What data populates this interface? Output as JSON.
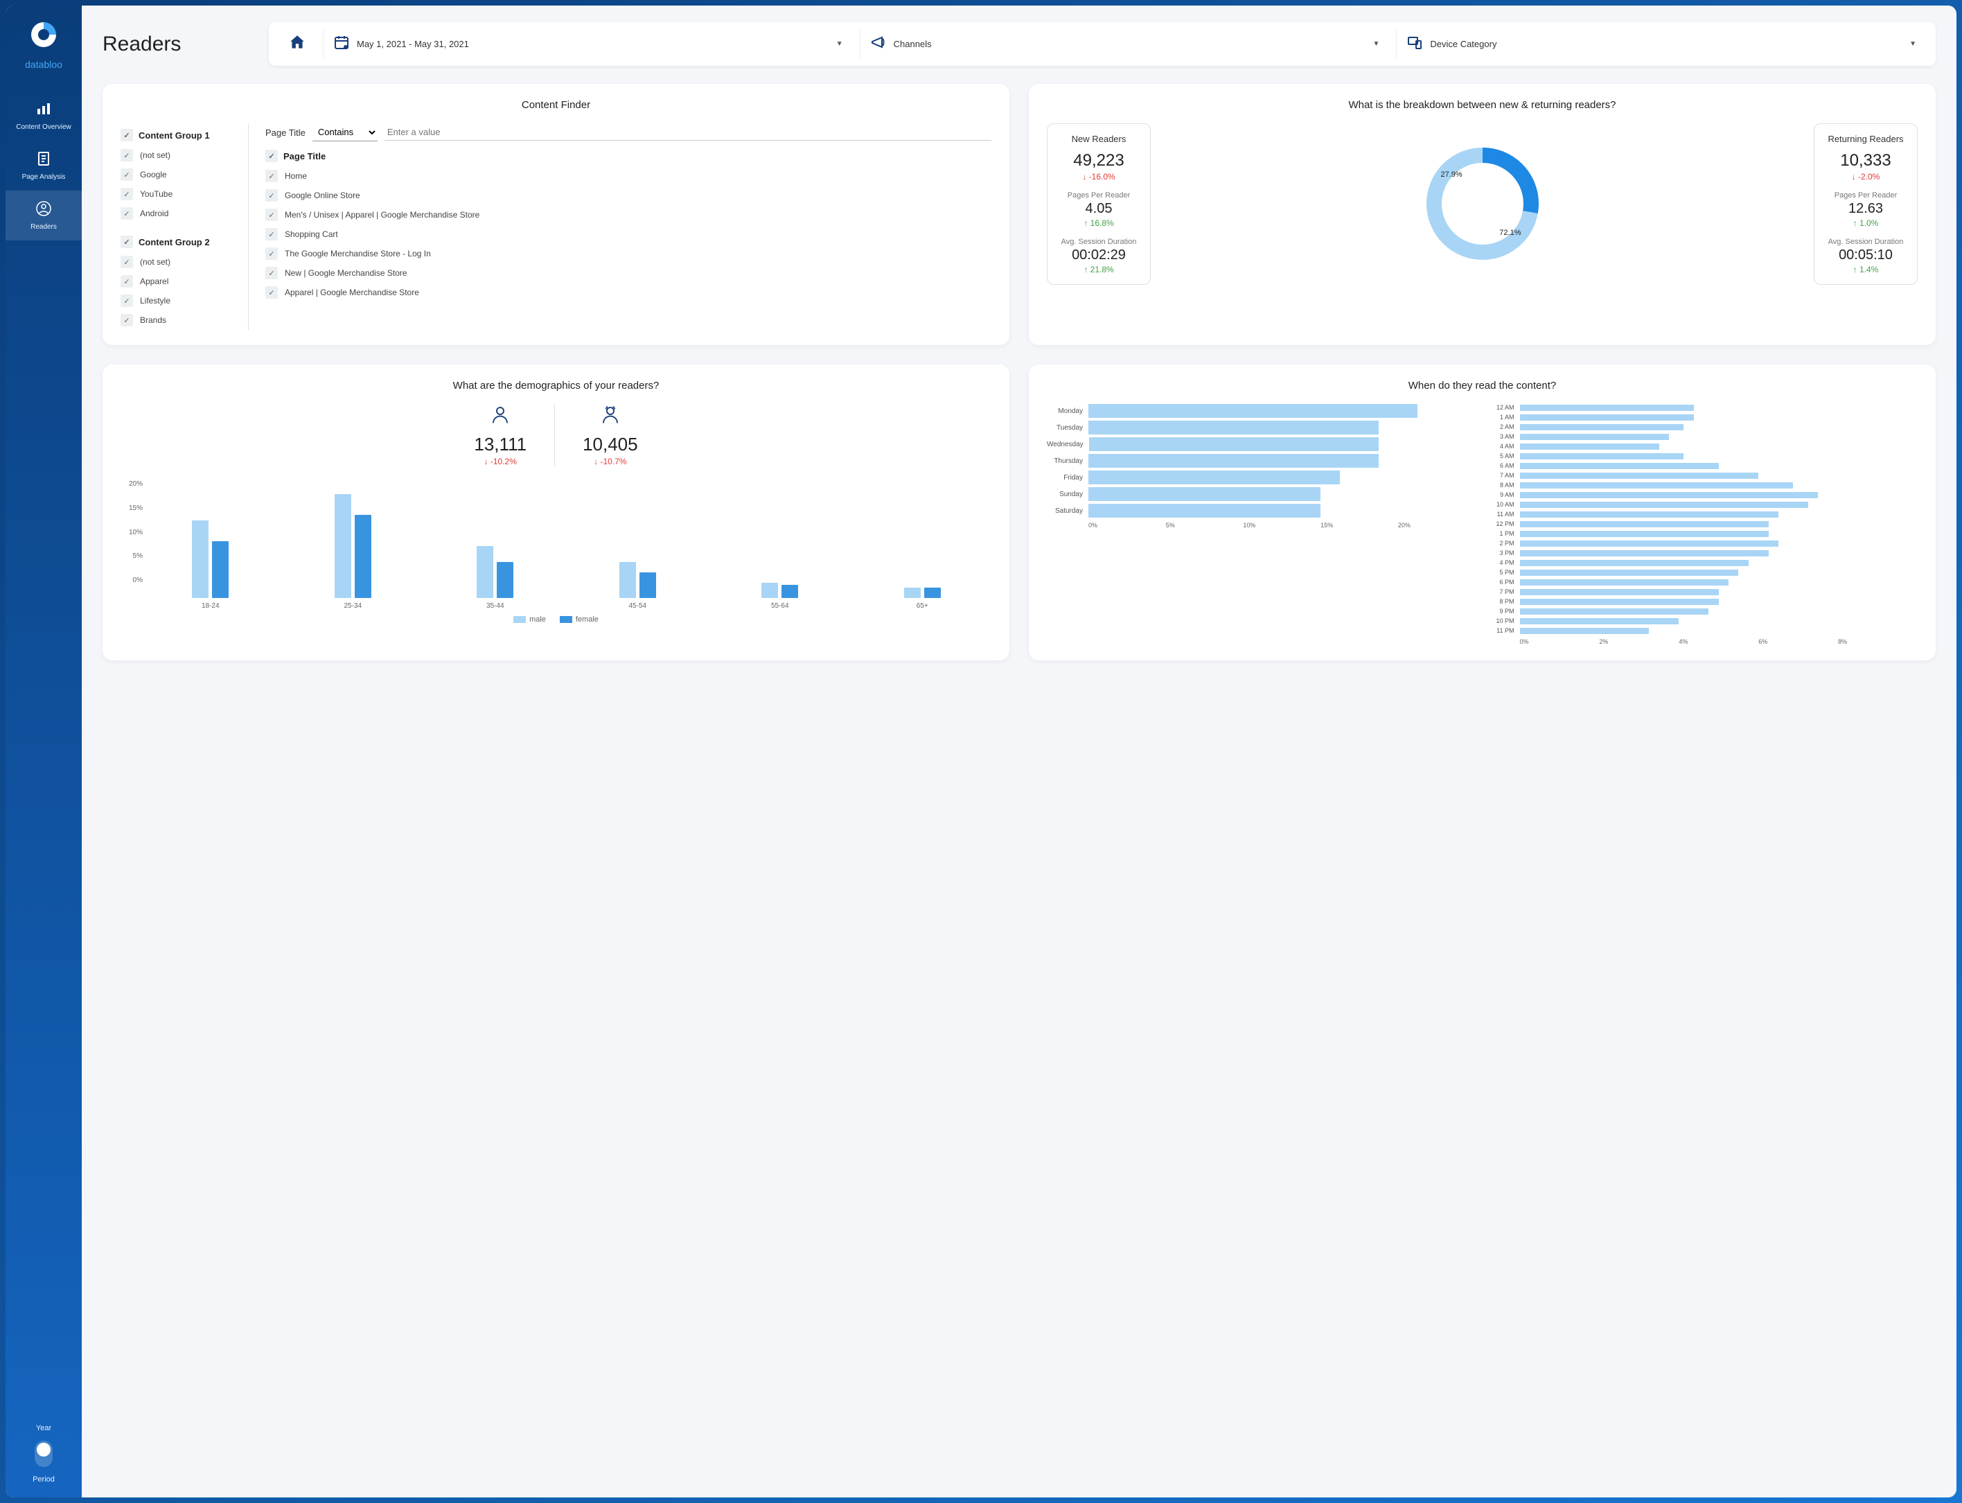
{
  "brand": "databloo",
  "nav": {
    "items": [
      {
        "label": "Content Overview"
      },
      {
        "label": "Page Analysis"
      },
      {
        "label": "Readers"
      }
    ],
    "year_label": "Year",
    "period_label": "Period"
  },
  "header": {
    "title": "Readers",
    "date_range": "May 1, 2021 - May 31, 2021",
    "channels_label": "Channels",
    "device_label": "Device Category"
  },
  "finder": {
    "title": "Content Finder",
    "group1_title": "Content Group 1",
    "group1_items": [
      "(not set)",
      "Google",
      "YouTube",
      "Android"
    ],
    "group2_title": "Content Group 2",
    "group2_items": [
      "(not set)",
      "Apparel",
      "Lifestyle",
      "Brands"
    ],
    "page_title_label": "Page Title",
    "contains_label": "Contains",
    "enter_value_placeholder": "Enter a value",
    "page_title_header": "Page Title",
    "pages": [
      "Home",
      "Google Online Store",
      "Men's / Unisex | Apparel | Google Merchandise Store",
      "Shopping Cart",
      "The Google Merchandise Store - Log In",
      "New | Google Merchandise Store",
      "Apparel | Google Merchandise Store"
    ]
  },
  "breakdown": {
    "title": "What is the breakdown between new & returning readers?",
    "new": {
      "title": "New Readers",
      "value": "49,223",
      "delta": "↓ -16.0%",
      "ppr_label": "Pages Per Reader",
      "ppr": "4.05",
      "ppr_delta": "↑ 16.8%",
      "asd_label": "Avg. Session Duration",
      "asd": "00:02:29",
      "asd_delta": "↑ 21.8%"
    },
    "returning": {
      "title": "Returning Readers",
      "value": "10,333",
      "delta": "↓ -2.0%",
      "ppr_label": "Pages Per Reader",
      "ppr": "12.63",
      "ppr_delta": "↑ 1.0%",
      "asd_label": "Avg. Session Duration",
      "asd": "00:05:10",
      "asd_delta": "↑ 1.4%"
    },
    "donut": {
      "new_pct": "27.9%",
      "returning_pct": "72.1%"
    }
  },
  "demographics": {
    "title": "What are the demographics of your readers?",
    "male": {
      "value": "13,111",
      "delta": "↓ -10.2%"
    },
    "female": {
      "value": "10,405",
      "delta": "↓ -10.7%"
    },
    "legend_male": "male",
    "legend_female": "female"
  },
  "timing": {
    "title": "When do they read the content?"
  },
  "chart_data": [
    {
      "type": "pie",
      "title": "New vs Returning Readers",
      "series": [
        {
          "name": "New Readers",
          "value": 27.9
        },
        {
          "name": "Returning Readers",
          "value": 72.1
        }
      ]
    },
    {
      "type": "bar",
      "title": "Demographics by age bracket",
      "categories": [
        "18-24",
        "25-34",
        "35-44",
        "45-54",
        "55-64",
        "65+"
      ],
      "series": [
        {
          "name": "male",
          "values": [
            15,
            20,
            10,
            7,
            3,
            2
          ]
        },
        {
          "name": "female",
          "values": [
            11,
            16,
            7,
            5,
            2.5,
            2
          ]
        }
      ],
      "ylabel": "%",
      "ylim": [
        0,
        20
      ],
      "yticks": [
        "20%",
        "15%",
        "10%",
        "5%",
        "0%"
      ]
    },
    {
      "type": "bar",
      "title": "Reads by day of week",
      "orientation": "horizontal",
      "categories": [
        "Monday",
        "Tuesday",
        "Wednesday",
        "Thursday",
        "Friday",
        "Sunday",
        "Saturday"
      ],
      "values": [
        17,
        15,
        15,
        15,
        13,
        12,
        12
      ],
      "xlabel": "%",
      "xlim": [
        0,
        20
      ],
      "xticks": [
        "0%",
        "5%",
        "10%",
        "15%",
        "20%"
      ]
    },
    {
      "type": "bar",
      "title": "Reads by hour of day",
      "orientation": "horizontal",
      "categories": [
        "12 AM",
        "1 AM",
        "2 AM",
        "3 AM",
        "4 AM",
        "5 AM",
        "6 AM",
        "7 AM",
        "8 AM",
        "9 AM",
        "10 AM",
        "11 AM",
        "12 PM",
        "1 PM",
        "2 PM",
        "3 PM",
        "4 PM",
        "5 PM",
        "6 PM",
        "7 PM",
        "8 PM",
        "9 PM",
        "10 PM",
        "11 PM"
      ],
      "values": [
        3.5,
        3.5,
        3.3,
        3.0,
        2.8,
        3.3,
        4.0,
        4.8,
        5.5,
        6.0,
        5.8,
        5.2,
        5.0,
        5.0,
        5.2,
        5.0,
        4.6,
        4.4,
        4.2,
        4.0,
        4.0,
        3.8,
        3.2,
        2.6
      ],
      "xlabel": "%",
      "xlim": [
        0,
        8
      ],
      "xticks": [
        "0%",
        "2%",
        "4%",
        "6%",
        "8%"
      ]
    }
  ]
}
